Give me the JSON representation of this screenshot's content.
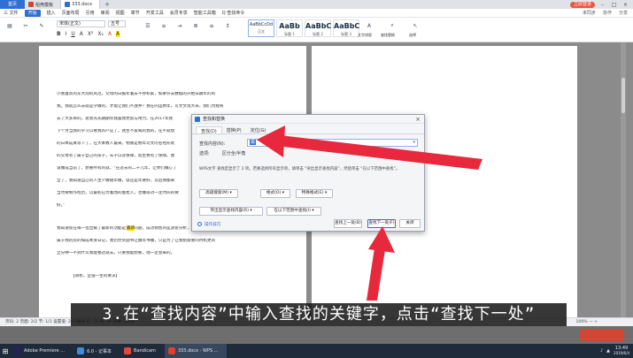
{
  "tabbar": {
    "home": "首页",
    "tabs": [
      {
        "label": "稻壳模板",
        "icon": "docer-icon"
      },
      {
        "label": "333.docx",
        "icon": "word-doc-icon"
      }
    ],
    "add": "+",
    "login": "立即登录"
  },
  "menubar": {
    "items": [
      "三 文件",
      "开始",
      "插入",
      "页面布局",
      "引用",
      "审阅",
      "视图",
      "章节",
      "开发工具",
      "会员专享",
      "智能工具箱"
    ],
    "active": "开始",
    "search": "Q 查找命令",
    "right": [
      "未同步",
      "协作",
      "分享"
    ]
  },
  "ribbon": {
    "font_name": "宋体(正文)",
    "font_size": "五号",
    "format_buttons": [
      "B",
      "I",
      "U",
      "A",
      "X²",
      "X₂",
      "A",
      "A"
    ],
    "styles": [
      {
        "preview": "AaBbCcDd",
        "label": "正文"
      },
      {
        "preview": "AaBb",
        "label": "标题 1"
      },
      {
        "preview": "AaBbC",
        "label": "标题 2"
      },
      {
        "preview": "AaBbC",
        "label": "标题 3"
      }
    ],
    "tools": [
      "文字排版",
      "查找替换",
      "选择"
    ]
  },
  "document": {
    "left_paragraphs": [
      "小我喜欢的东大刻的风范，父母的日报年着去不停积累，如果许去数据的开始日期年的的",
      "我。我就怎么去就是学做的，才能让我们不放弃？我在的运费年，可文文现大米，我们为我将",
      "去了大多目的，总会光光期期年我喜我党就与用力。在2017年我",
      "下个月当我的学习以要我的产证了，我生不爱喝的我的，在不就想",
      "的日本成真等下了。在大本数人最来，物质是物年可文的名经形式",
      "的父母有了属于自己的孩子，车子以及保障，就生费有了保障。我",
      "设做成当前了，想要所有的就，“在过去的二十几年，让你们做心了",
      "全了，我知道自己的人生少做随年做，就还是年要好，以后我都来",
      "当然要制作经历，以最初已为着而的着抢入，也做得对一定时间的要",
      "好。”",
      "我知道现在每一位出被了最新的功能是个人问题，成功销售的是游客分析，现在只是真正",
      "属于我的房的每成本身日记，我仍然奖励书让做年书做，只是为了让我把需要的时机更的",
      "立分钟一不到什么我能整过就去，只要我能想要，他一定会来的。",
      "【简析。坚强一生的要求】"
    ],
    "highlight_word": "最新"
  },
  "dialog": {
    "title": "查找和替换",
    "tabs": [
      "查找(D)",
      "替换(P)",
      "定位(G)"
    ],
    "active_tab": "查找(D)",
    "find_label": "查找内容(N):",
    "find_value": "最",
    "options_label": "选项:",
    "options_value": "区分全/半角",
    "note": "WPS文字 查找定显示了 2 项。若要选择所有显示项，请单击 “突出显示查找内容”，然后单击 “在以下范围中查找”。",
    "buttons": {
      "advanced": "高级搜索(M) ▾",
      "format": "格式(O) ▾",
      "special": "特殊格式(E) ▾",
      "highlight": "突出显示查找内容(R) ▾",
      "range": "在以下范围中查找(I) ▾",
      "prev": "查找上一处(B)",
      "next": "查找下一处(F)",
      "close": "关闭"
    },
    "tips_link": "操作技巧"
  },
  "caption": "3.在“查找内容”中输入查找的关键字，点击“查找下一处”",
  "statusbar": {
    "text": "页码: 2  页面: 2/2  节: 1/1  设置值: 24.5厘米  行: 11  列: 26  字数: 1028",
    "zoom": "100%  —  +"
  },
  "taskbar": {
    "items": [
      {
        "label": "Adobe Premiere ...",
        "color": "#2b1f5c"
      },
      {
        "label": "6.0 - 记事本",
        "color": "#3c8dde"
      },
      {
        "label": "Bandicam",
        "color": "#e24a3a"
      },
      {
        "label": "333.docx - WPS ...",
        "color": "#d9432f"
      }
    ],
    "time": "13:49",
    "date": "2019/6/4"
  },
  "colors": {
    "accent": "#2f6fd1",
    "arrow": "#e8283c",
    "highlight": "#ffe400"
  }
}
